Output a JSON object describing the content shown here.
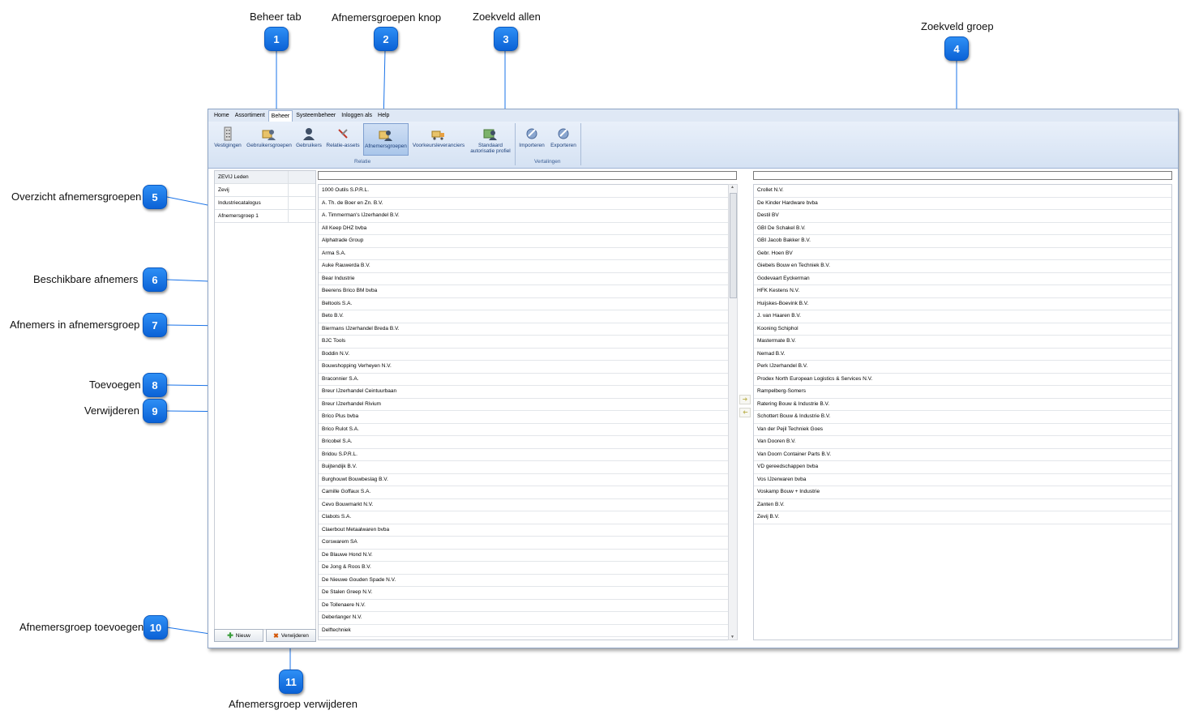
{
  "annotations": {
    "beheer_tab": "Beheer tab",
    "afnemersgroepen_knop": "Afnemersgroepen knop",
    "zoekveld_allen": "Zoekveld allen",
    "zoekveld_groep": "Zoekveld groep",
    "overzicht": "Overzicht afnemersgroepen",
    "beschikbare": "Beschikbare afnemers",
    "afnemers_in_groep": "Afnemers in afnemersgroep",
    "toevoegen": "Toevoegen",
    "verwijderen": "Verwijderen",
    "groep_toevoegen": "Afnemersgroep toevoegen",
    "groep_verwijderen": "Afnemersgroep verwijderen"
  },
  "badges": [
    "1",
    "2",
    "3",
    "4",
    "5",
    "6",
    "7",
    "8",
    "9",
    "10",
    "11"
  ],
  "menu": [
    "Home",
    "Assortiment",
    "Beheer",
    "Systeembeheer",
    "Inloggen als",
    "Help"
  ],
  "ribbon": {
    "buttons": [
      "Vestigingen",
      "Gebruikersgroepen",
      "Gebruikers",
      "Relatie-assets",
      "Afnemersgroepen",
      "Voorkeursleveranciers",
      "Standaard autorisatie profiel",
      "Importeren",
      "Exporteren"
    ],
    "group_relatie": "Relatie",
    "group_vertalingen": "Vertalingen"
  },
  "groups": [
    "ZEVIJ Leden",
    "Zevij",
    "Industriecatalogus",
    "Afnemersgroep 1"
  ],
  "buttons": {
    "nieuw": "Nieuw",
    "verwijderen": "Verwijderen"
  },
  "available": [
    "1000 Outils S.P.R.L.",
    "A. Th. de Boer en Zn. B.V.",
    "A. Timmerman's IJzerhandel B.V.",
    "All Keep DHZ bvba",
    "Alphatrade Group",
    "Arma S.A.",
    "Auke Rauwerda B.V.",
    "Bear Industrie",
    "Beerens Brico BM bvba",
    "Beltools S.A.",
    "Beto B.V.",
    "Biermans IJzerhandel Breda B.V.",
    "BJC Tools",
    "Boddin N.V.",
    "Bouwshopping Verheyen N.V.",
    "Braconnier S.A.",
    "Breur IJzerhandel Ceintuurbaan",
    "Breur IJzerhandel Rivium",
    "Brico Plus bvba",
    "Brico Rulot S.A.",
    "Bricobel S.A.",
    "Bridou S.P.R.L.",
    "Buijtendijk B.V.",
    "Burghouwt Bouwbeslag B.V.",
    "Camille Goffaux S.A.",
    "Cevo Bouwmarkt N.V.",
    "Clabots S.A.",
    "Claerbout Metaalwaren bvba",
    "Corswarem SA",
    "De Blauwe Hond N.V.",
    "De Jong & Roos B.V.",
    "De Nieuwe Gouden Spade N.V.",
    "De Stalen Greep N.V.",
    "De Tollenaere N.V.",
    "Deberlanger N.V.",
    "Delftechniek"
  ],
  "in_group": [
    "Crollet N.V.",
    "De Kinder Hardware bvba",
    "Destil BV",
    "GBI De Schakel B.V.",
    "GBI Jacob Bakker B.V.",
    "Gebr. Hoen BV",
    "Giebels Bouw en Techniek B.V.",
    "Godevaart Eyckerman",
    "HFK Kestens N.V.",
    "Huijskes-Boevink B.V.",
    "J. van Haaren B.V.",
    "Kooning Schiphol",
    "Mastermate B.V.",
    "Nemad B.V.",
    "Perk IJzerhandel B.V.",
    "Prodex North European Logistics & Services N.V.",
    "Rampelberg-Somers",
    "Ratering Bouw & Industrie B.V.",
    "Schottert Bouw & Industrie B.V.",
    "Van der Pejil Techniek Goes",
    "Van Dooren B.V.",
    "Van Doorn Container Parts B.V.",
    "VD gereedschappen bvba",
    "Vos IJzerwaren bvba",
    "Voskamp Bouw + Industrie",
    "Zanten B.V.",
    "Zevij B.V."
  ],
  "colors": {
    "badge": "#1a73e8",
    "leader_line": "#1a73e8",
    "ribbon": "#dfe8f5"
  }
}
